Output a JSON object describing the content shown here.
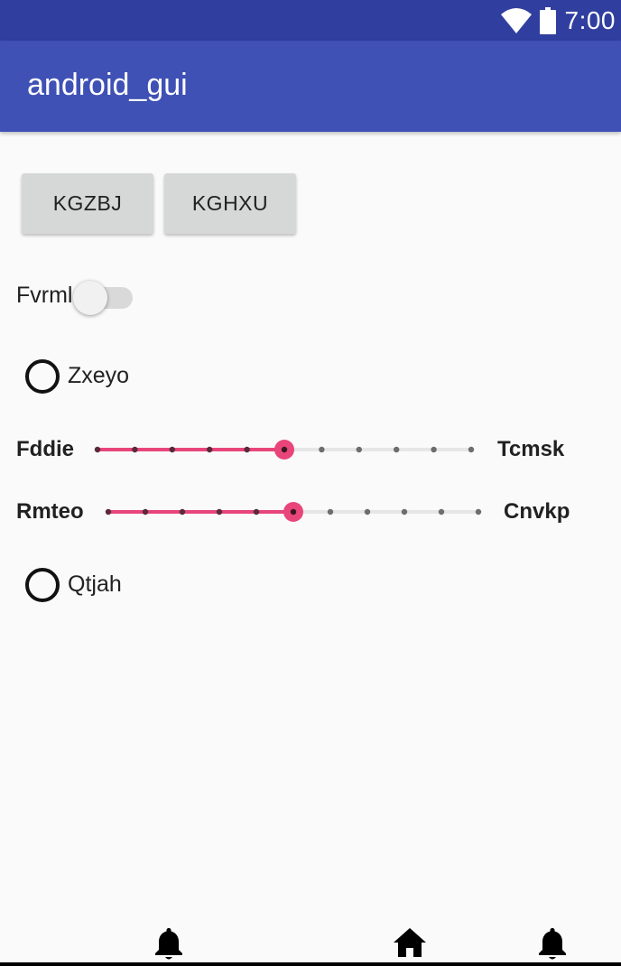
{
  "status_bar": {
    "time": "7:00",
    "icons": [
      "wifi-icon",
      "battery-icon"
    ]
  },
  "app_bar": {
    "title": "android_gui"
  },
  "buttons": [
    {
      "label": "KGZBJ"
    },
    {
      "label": "KGHXU"
    }
  ],
  "switch": {
    "label": "Fvrml",
    "checked": false
  },
  "radios": [
    {
      "label": "Zxeyo",
      "checked": false
    },
    {
      "label": "Qtjah",
      "checked": false
    }
  ],
  "sliders": [
    {
      "left_label": "Fddie",
      "right_label": "Tcmsk",
      "steps": 10,
      "value": 5
    },
    {
      "left_label": "Rmteo",
      "right_label": "Cnvkp",
      "steps": 10,
      "value": 5
    }
  ],
  "nav_bar": {
    "icons": [
      "bell-icon",
      "home-icon",
      "bell-icon"
    ]
  },
  "colors": {
    "status_bar": "#303f9f",
    "app_bar": "#3f51b5",
    "accent": "#ff4081",
    "slider_active": "#e8457a",
    "background": "#fafafa"
  }
}
